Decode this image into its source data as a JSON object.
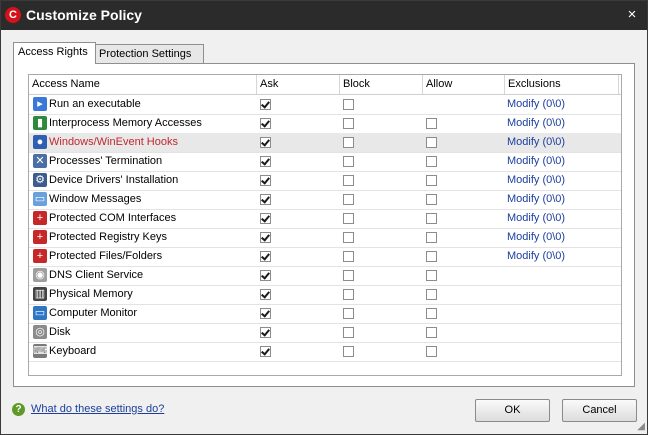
{
  "window": {
    "title": "Customize Policy",
    "logo_text": "C",
    "close_glyph": "×"
  },
  "tabs": [
    {
      "label": "Access Rights",
      "active": true
    },
    {
      "label": "Protection Settings",
      "active": false
    }
  ],
  "table": {
    "columns": [
      "Access Name",
      "Ask",
      "Block",
      "Allow",
      "Exclusions"
    ],
    "rows": [
      {
        "name": "Run an executable",
        "icon": "executable-icon",
        "ask": true,
        "block": false,
        "allow": null,
        "exclusions": "Modify (0\\0)"
      },
      {
        "name": "Interprocess Memory Accesses",
        "icon": "memory-access-icon",
        "ask": true,
        "block": false,
        "allow": false,
        "exclusions": "Modify (0\\0)"
      },
      {
        "name": "Windows/WinEvent Hooks",
        "icon": "hooks-icon",
        "ask": true,
        "block": false,
        "allow": false,
        "exclusions": "Modify (0\\0)",
        "highlighted": true
      },
      {
        "name": "Processes' Termination",
        "icon": "process-termination-icon",
        "ask": true,
        "block": false,
        "allow": false,
        "exclusions": "Modify (0\\0)"
      },
      {
        "name": "Device Drivers' Installation",
        "icon": "device-driver-icon",
        "ask": true,
        "block": false,
        "allow": false,
        "exclusions": "Modify (0\\0)"
      },
      {
        "name": "Window Messages",
        "icon": "window-messages-icon",
        "ask": true,
        "block": false,
        "allow": false,
        "exclusions": "Modify (0\\0)"
      },
      {
        "name": "Protected COM Interfaces",
        "icon": "com-interfaces-icon",
        "ask": true,
        "block": false,
        "allow": false,
        "exclusions": "Modify (0\\0)"
      },
      {
        "name": "Protected Registry Keys",
        "icon": "registry-keys-icon",
        "ask": true,
        "block": false,
        "allow": false,
        "exclusions": "Modify (0\\0)"
      },
      {
        "name": "Protected Files/Folders",
        "icon": "files-folders-icon",
        "ask": true,
        "block": false,
        "allow": false,
        "exclusions": "Modify (0\\0)"
      },
      {
        "name": "DNS Client Service",
        "icon": "dns-client-icon",
        "ask": true,
        "block": false,
        "allow": false,
        "exclusions": ""
      },
      {
        "name": "Physical Memory",
        "icon": "physical-memory-icon",
        "ask": true,
        "block": false,
        "allow": false,
        "exclusions": ""
      },
      {
        "name": "Computer Monitor",
        "icon": "computer-monitor-icon",
        "ask": true,
        "block": false,
        "allow": false,
        "exclusions": ""
      },
      {
        "name": "Disk",
        "icon": "disk-icon",
        "ask": true,
        "block": false,
        "allow": false,
        "exclusions": ""
      },
      {
        "name": "Keyboard",
        "icon": "keyboard-icon",
        "ask": true,
        "block": false,
        "allow": false,
        "exclusions": ""
      }
    ]
  },
  "footer": {
    "help_link": "What do these settings do?",
    "help_glyph": "?",
    "ok_label": "OK",
    "cancel_label": "Cancel"
  },
  "colors": {
    "titlebar": "#2b2b2b",
    "brand_red": "#d3121c",
    "link_blue": "#1c3f9e",
    "highlight_text": "#c0282d"
  }
}
